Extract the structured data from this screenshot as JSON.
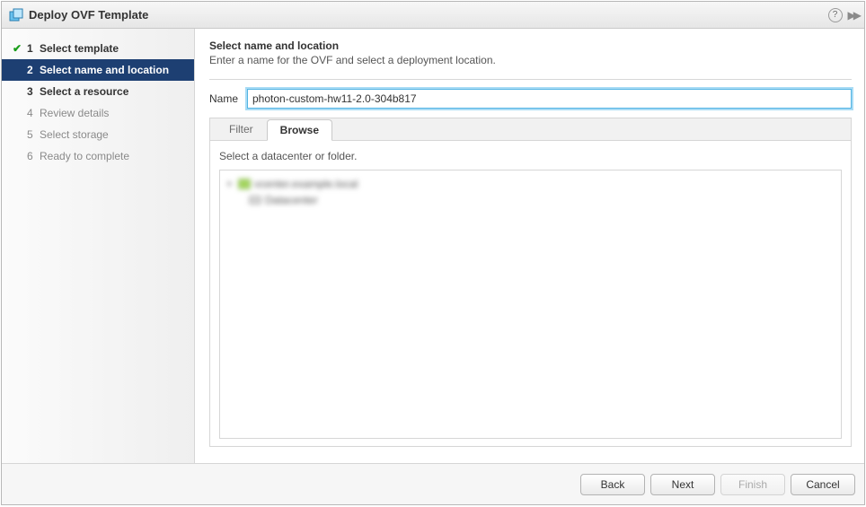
{
  "window": {
    "title": "Deploy OVF Template"
  },
  "steps": [
    {
      "num": "1",
      "label": "Select template",
      "state": "completed"
    },
    {
      "num": "2",
      "label": "Select name and location",
      "state": "active"
    },
    {
      "num": "3",
      "label": "Select a resource",
      "state": "enabled"
    },
    {
      "num": "4",
      "label": "Review details",
      "state": "disabled"
    },
    {
      "num": "5",
      "label": "Select storage",
      "state": "disabled"
    },
    {
      "num": "6",
      "label": "Ready to complete",
      "state": "disabled"
    }
  ],
  "page": {
    "heading": "Select name and location",
    "subtitle": "Enter a name for the OVF and select a deployment location.",
    "name_label": "Name",
    "name_value": "photon-custom-hw11-2.0-304b817",
    "tabs": {
      "filter": "Filter",
      "browse": "Browse"
    },
    "browse_instruction": "Select a datacenter or folder.",
    "tree": {
      "root": "vcenter.example.local",
      "child": "Datacenter"
    }
  },
  "buttons": {
    "back": "Back",
    "next": "Next",
    "finish": "Finish",
    "cancel": "Cancel"
  }
}
